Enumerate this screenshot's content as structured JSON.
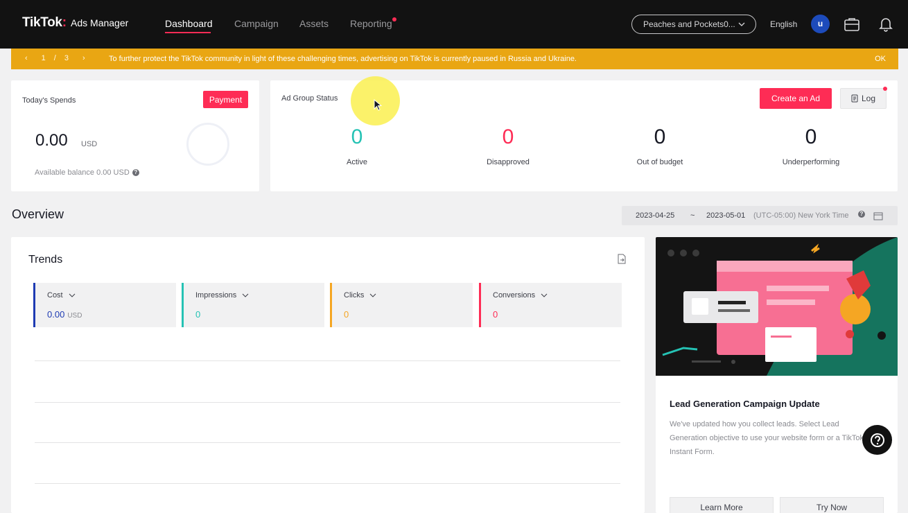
{
  "nav": {
    "brand": "TikTok",
    "brand_dot": ":",
    "product": "Ads Manager",
    "items": [
      {
        "label": "Dashboard"
      },
      {
        "label": "Campaign"
      },
      {
        "label": "Assets"
      },
      {
        "label": "Reporting"
      }
    ],
    "account": "Peaches and Pockets0...",
    "language": "English",
    "avatar_initial": "u"
  },
  "banner": {
    "page_current": "1",
    "page_sep": "/",
    "page_total": "3",
    "message": "To further protect the TikTok community in light of these challenging times, advertising on TikTok is currently paused in Russia and Ukraine.",
    "ok_label": "OK"
  },
  "spends": {
    "title": "Today's Spends",
    "payment_label": "Payment",
    "amount": "0.00",
    "currency": "USD",
    "balance_text": "Available balance 0.00 USD"
  },
  "ad_group": {
    "title": "Ad Group Status",
    "create_label": "Create an Ad",
    "log_label": "Log",
    "stats": [
      {
        "value": "0",
        "label": "Active",
        "color": "#25c2b4"
      },
      {
        "value": "0",
        "label": "Disapproved",
        "color": "#fe2c55"
      },
      {
        "value": "0",
        "label": "Out of budget",
        "color": "#161823"
      },
      {
        "value": "0",
        "label": "Underperforming",
        "color": "#161823"
      }
    ]
  },
  "overview": {
    "title": "Overview",
    "date_start": "2023-04-25",
    "date_sep": "~",
    "date_end": "2023-05-01",
    "timezone": "(UTC-05:00) New York Time"
  },
  "trends": {
    "title": "Trends",
    "metrics": [
      {
        "name": "Cost",
        "value": "0.00",
        "unit": "USD",
        "color": "#1e3bb3"
      },
      {
        "name": "Impressions",
        "value": "0",
        "unit": "",
        "color": "#25c2b4"
      },
      {
        "name": "Clicks",
        "value": "0",
        "unit": "",
        "color": "#f5a623"
      },
      {
        "name": "Conversions",
        "value": "0",
        "unit": "",
        "color": "#fe2c55"
      }
    ]
  },
  "promo": {
    "title": "Lead Generation Campaign Update",
    "description": "We've updated how you collect leads. Select Lead Generation objective to use your website form or a TikTok Instant Form.",
    "learn_more": "Learn More",
    "try_now": "Try Now"
  },
  "colors": {
    "accent": "#fe2c55",
    "banner": "#e9a613",
    "nav_bg": "#121212"
  }
}
